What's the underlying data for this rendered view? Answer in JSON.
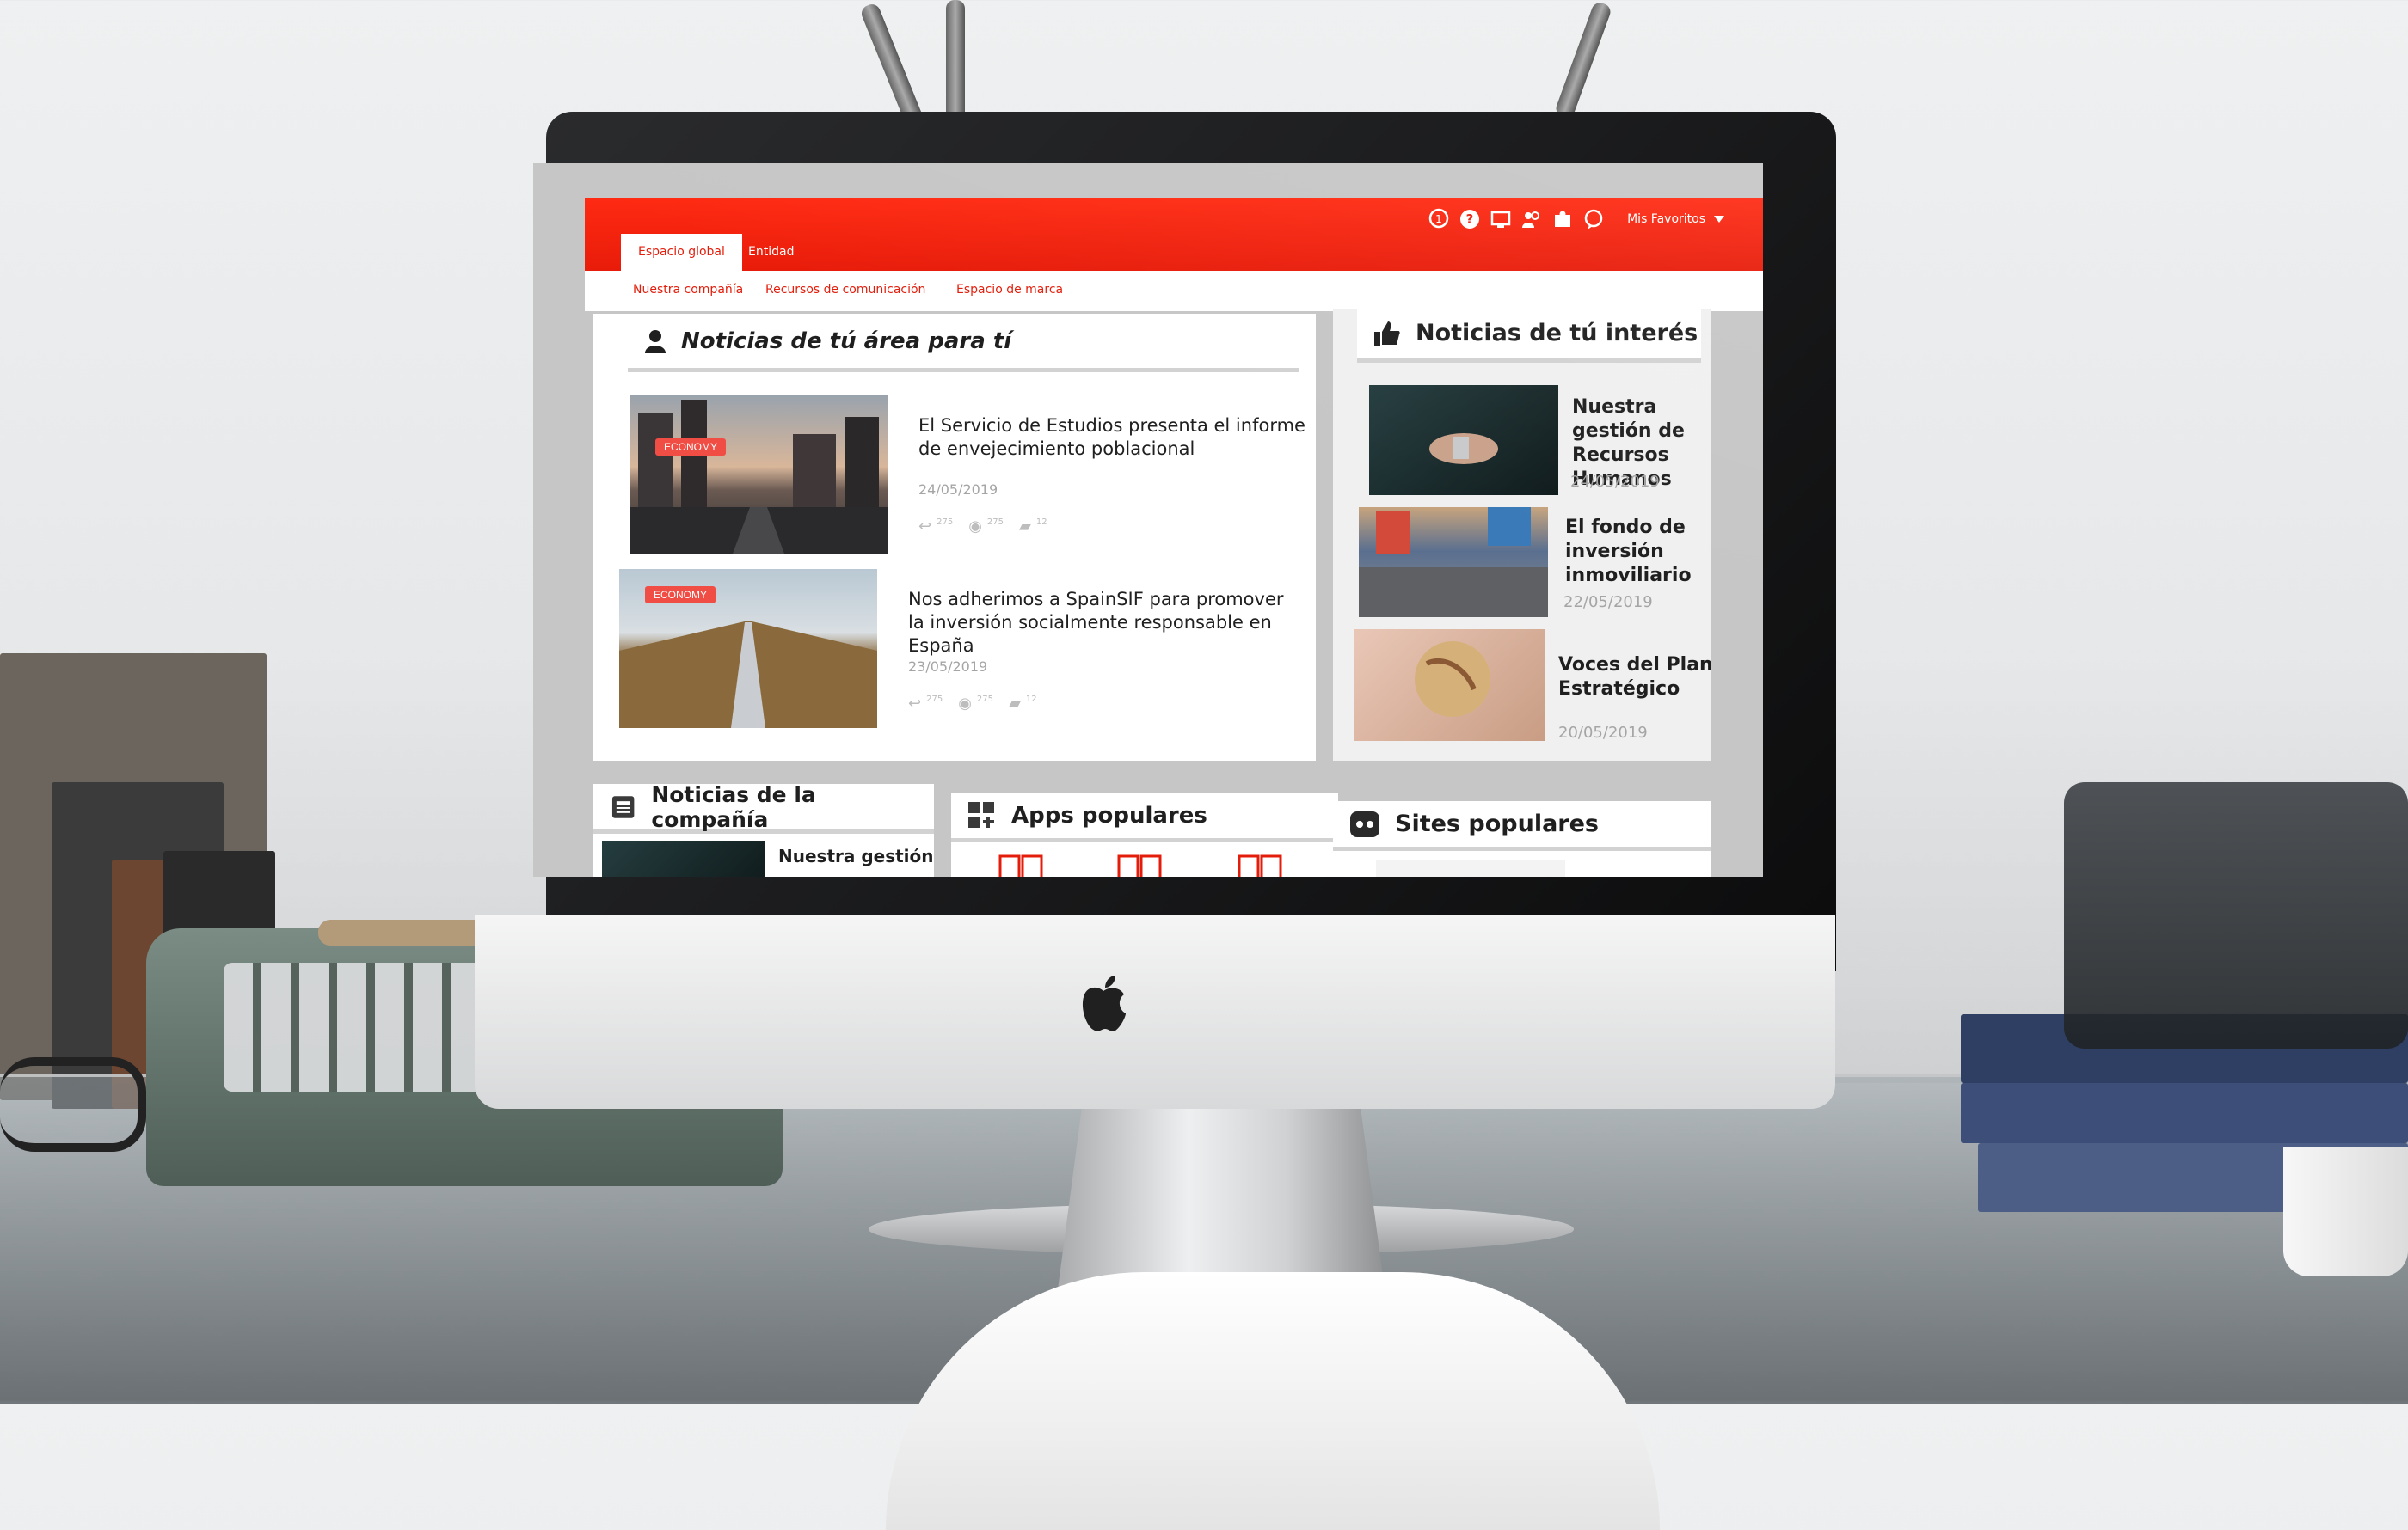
{
  "topbar": {
    "tabs": [
      {
        "label": "Espacio global",
        "active": true
      },
      {
        "label": "Entidad",
        "active": false
      }
    ],
    "icons": [
      "notification-icon",
      "help-icon",
      "screen-icon",
      "people-icon",
      "plugin-icon",
      "chat-icon"
    ],
    "notification_count": "1",
    "favorites_label": "Mis Favoritos",
    "accent_color": "#ff2a12"
  },
  "subnav": {
    "items": [
      "Nuestra compañía",
      "Recursos de comunicación",
      "Espacio de marca"
    ]
  },
  "area_news": {
    "title": "Noticias de tú área para tí",
    "items": [
      {
        "badge": "ECONOMY",
        "title": "El Servicio de Estudios presenta el informe de envejecimiento poblacional",
        "date": "24/05/2019",
        "shares": "275",
        "views": "275",
        "comments": "12"
      },
      {
        "badge": "ECONOMY",
        "title": "Nos adherimos a SpainSIF para promover la inversión socialmente responsable en España",
        "date": "23/05/2019",
        "shares": "275",
        "views": "275",
        "comments": "12"
      }
    ]
  },
  "interest_news": {
    "title": "Noticias de tú interés",
    "items": [
      {
        "title": "Nuestra gestión de Recursos Humanos",
        "date": "24/05/2019"
      },
      {
        "title": "El fondo de inversión inmoviliario",
        "date": "22/05/2019"
      },
      {
        "title": "Voces del Plan Estratégico",
        "date": "20/05/2019"
      }
    ]
  },
  "company_news": {
    "title": "Noticias de la compañía",
    "item_title": "Nuestra gestión"
  },
  "apps": {
    "title": "Apps populares"
  },
  "sites": {
    "title": "Sites populares"
  }
}
